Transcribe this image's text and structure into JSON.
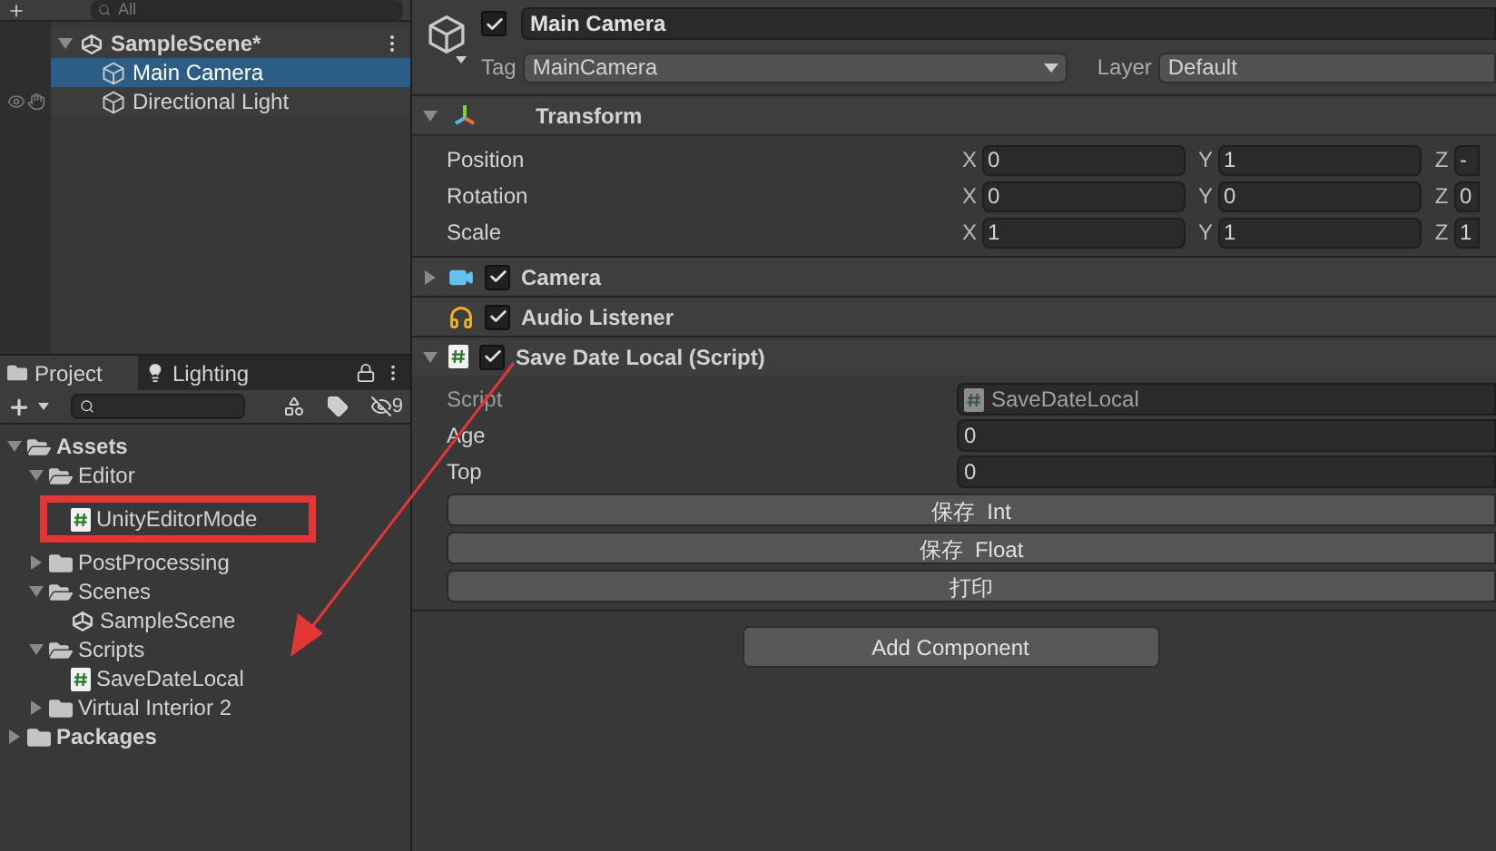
{
  "hierarchy": {
    "search_placeholder": "All",
    "scene": {
      "name": "SampleScene*",
      "expanded": true
    },
    "items": [
      {
        "name": "Main Camera",
        "selected": true
      },
      {
        "name": "Directional Light",
        "selected": false
      }
    ]
  },
  "project": {
    "tabs": [
      {
        "label": "Project",
        "selected": true,
        "kind": "folder"
      },
      {
        "label": "Lighting",
        "selected": false,
        "kind": "light"
      }
    ],
    "hidden_count": "9",
    "tree": [
      {
        "name": "Assets",
        "kind": "folder",
        "expanded": true,
        "children": [
          {
            "name": "Editor",
            "kind": "folder",
            "expanded": true,
            "children": [
              {
                "name": "UnityEditorMode",
                "kind": "script",
                "highlighted": true
              }
            ]
          },
          {
            "name": "PostProcessing",
            "kind": "folder",
            "expanded": false
          },
          {
            "name": "Scenes",
            "kind": "folder",
            "expanded": true,
            "children": [
              {
                "name": "SampleScene",
                "kind": "scene"
              }
            ]
          },
          {
            "name": "Scripts",
            "kind": "folder",
            "expanded": true,
            "children": [
              {
                "name": "SaveDateLocal",
                "kind": "script",
                "highlighted": false
              }
            ]
          },
          {
            "name": "Virtual Interior 2",
            "kind": "folder",
            "expanded": false
          }
        ]
      },
      {
        "name": "Packages",
        "kind": "folder",
        "expanded": false
      }
    ]
  },
  "inspector": {
    "object": {
      "active": true,
      "name": "Main Camera",
      "tag_label": "Tag",
      "tag": "MainCamera",
      "layer_label": "Layer",
      "layer": "Default"
    },
    "transform": {
      "title": "Transform",
      "expanded": true,
      "rows": [
        {
          "label": "Position",
          "axes": [
            "X",
            "Y",
            "Z"
          ],
          "values": [
            "0",
            "1",
            "-"
          ]
        },
        {
          "label": "Rotation",
          "axes": [
            "X",
            "Y",
            "Z"
          ],
          "values": [
            "0",
            "0",
            "0"
          ]
        },
        {
          "label": "Scale",
          "axes": [
            "X",
            "Y",
            "Z"
          ],
          "values": [
            "1",
            "1",
            "1"
          ]
        }
      ]
    },
    "components": [
      {
        "name": "Camera",
        "kind": "camera",
        "enabled": true,
        "expanded": false
      },
      {
        "name": "Audio Listener",
        "kind": "audio",
        "enabled": true
      },
      {
        "name": "Save Date Local (Script)",
        "kind": "script",
        "enabled": true,
        "expanded": true,
        "fields": [
          {
            "label": "Script",
            "value": "SaveDateLocal",
            "disabled": true
          },
          {
            "label": "Age",
            "value": "0",
            "disabled": false
          },
          {
            "label": "Top",
            "value": "0",
            "disabled": false
          }
        ],
        "buttons": [
          "保存  Int",
          "保存  Float",
          "打印"
        ]
      }
    ],
    "add_button": "Add Component"
  }
}
